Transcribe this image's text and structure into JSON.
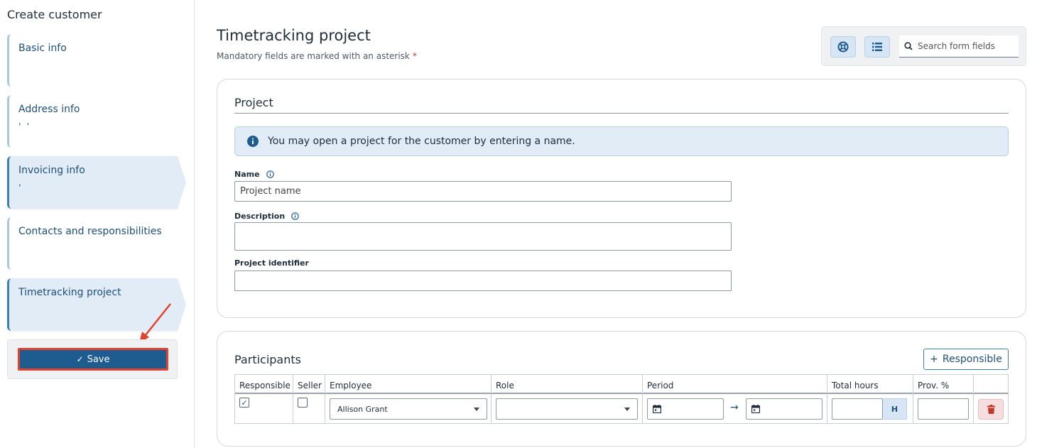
{
  "sidebar": {
    "title": "Create customer",
    "steps": [
      {
        "label": "Basic info",
        "sub": ""
      },
      {
        "label": "Address info",
        "sub": ", ,"
      },
      {
        "label": "Invoicing info",
        "sub": ","
      },
      {
        "label": "Contacts and responsibilities",
        "sub": ""
      },
      {
        "label": "Timetracking project",
        "sub": ""
      }
    ],
    "active_step": "Timetracking project",
    "save_label": "Save"
  },
  "header": {
    "title": "Timetracking project",
    "mandatory_note": "Mandatory fields are marked with an asterisk",
    "mandatory_star": "*",
    "search_placeholder": "Search form fields"
  },
  "project": {
    "section_title": "Project",
    "info_text": "You may open a project for the customer by entering a name.",
    "name_label": "Name",
    "name_placeholder": "Project name",
    "description_label": "Description",
    "identifier_label": "Project identifier"
  },
  "participants": {
    "section_title": "Participants",
    "add_button_label": "Responsible",
    "columns": [
      "Responsible",
      "Seller",
      "Employee",
      "Role",
      "Period",
      "Total hours",
      "Prov. %"
    ],
    "rows": [
      {
        "responsible": true,
        "seller": false,
        "employee": "Allison Grant",
        "role": "",
        "period_start": "",
        "period_end": "",
        "total_hours": "",
        "hours_unit": "H",
        "prov": ""
      }
    ]
  },
  "colors": {
    "primary": "#1e5b8e",
    "accent_light": "#e1ecf6",
    "annotation_red": "#e0432e",
    "danger": "#c0392b"
  }
}
